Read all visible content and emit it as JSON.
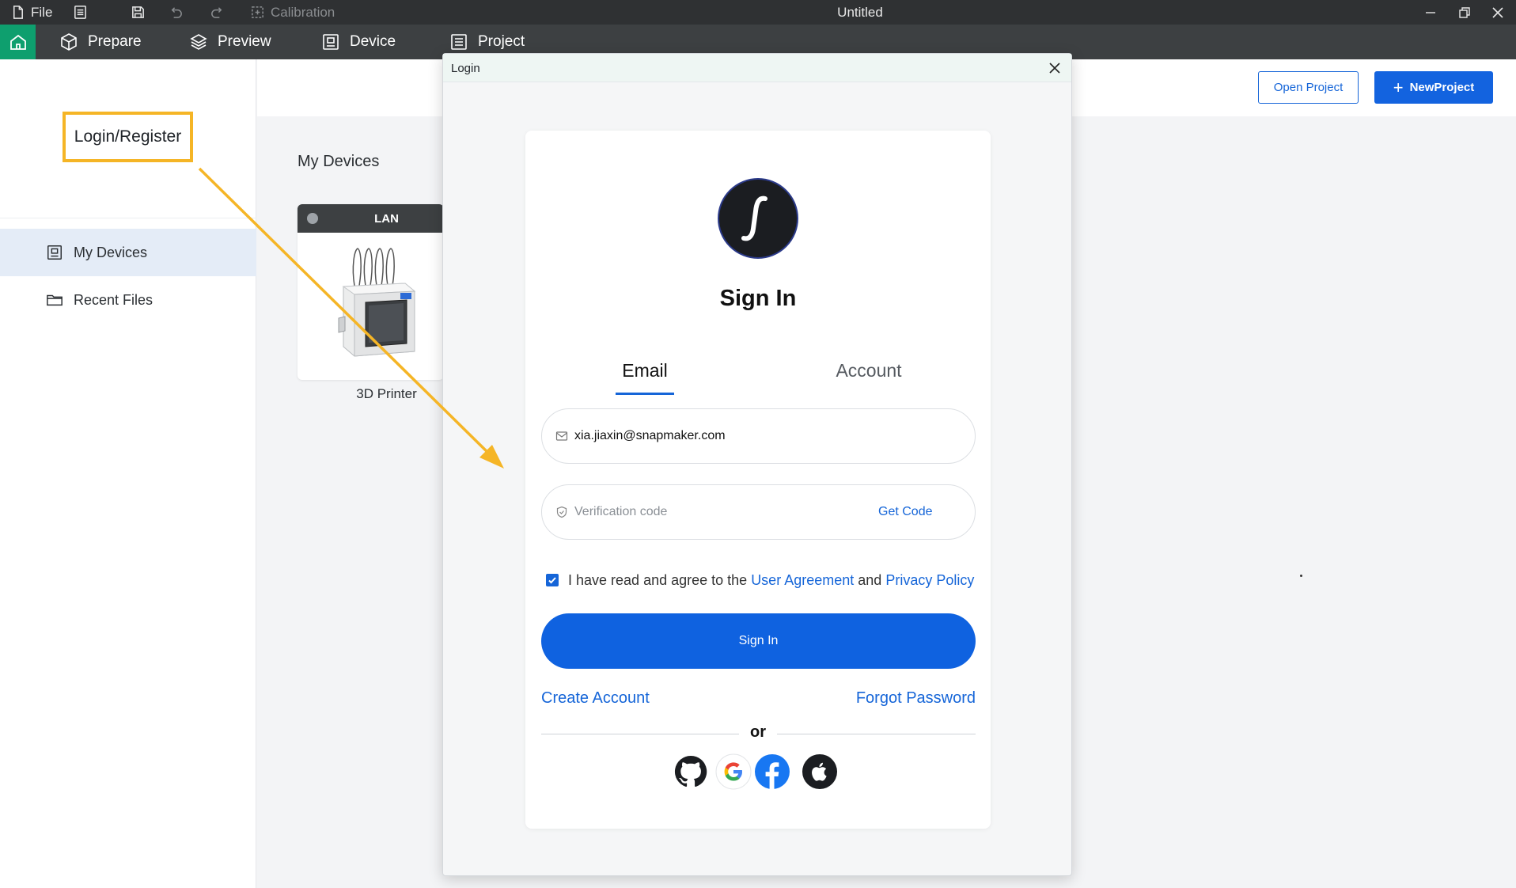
{
  "titlebar": {
    "file_label": "File",
    "calibration_label": "Calibration",
    "window_title": "Untitled"
  },
  "menubar": {
    "items": [
      {
        "label": "Prepare",
        "icon": "cube-icon"
      },
      {
        "label": "Preview",
        "icon": "layers-icon"
      },
      {
        "label": "Device",
        "icon": "device-icon"
      },
      {
        "label": "Project",
        "icon": "project-icon"
      }
    ]
  },
  "sidebar": {
    "login_label": "Login/Register",
    "items": [
      {
        "label": "My Devices",
        "icon": "device-icon",
        "active": true
      },
      {
        "label": "Recent Files",
        "icon": "folder-icon",
        "active": false
      }
    ]
  },
  "toolbar": {
    "open_project_label": "Open Project",
    "new_project_label": "NewProject"
  },
  "main": {
    "section_title": "My Devices",
    "device": {
      "connection": "LAN",
      "name": "3D Printer"
    }
  },
  "dialog": {
    "title": "Login",
    "heading": "Sign In",
    "tabs": [
      {
        "label": "Email",
        "active": true
      },
      {
        "label": "Account",
        "active": false
      }
    ],
    "email_value": "xia.jiaxin@snapmaker.com",
    "code_placeholder": "Verification code",
    "get_code_label": "Get Code",
    "agree": {
      "checked": true,
      "prefix": "I have read and agree to the",
      "user_agreement": "User Agreement",
      "and": "and",
      "privacy_policy": "Privacy Policy"
    },
    "signin_button": "Sign In",
    "create_account": "Create Account",
    "forgot_password": "Forgot Password",
    "or_label": "or",
    "social": [
      "github-icon",
      "google-icon",
      "facebook-icon",
      "apple-icon"
    ]
  },
  "colors": {
    "accent": "#1565d8",
    "home_green": "#0e9f6e",
    "annotation": "#f5b526"
  }
}
